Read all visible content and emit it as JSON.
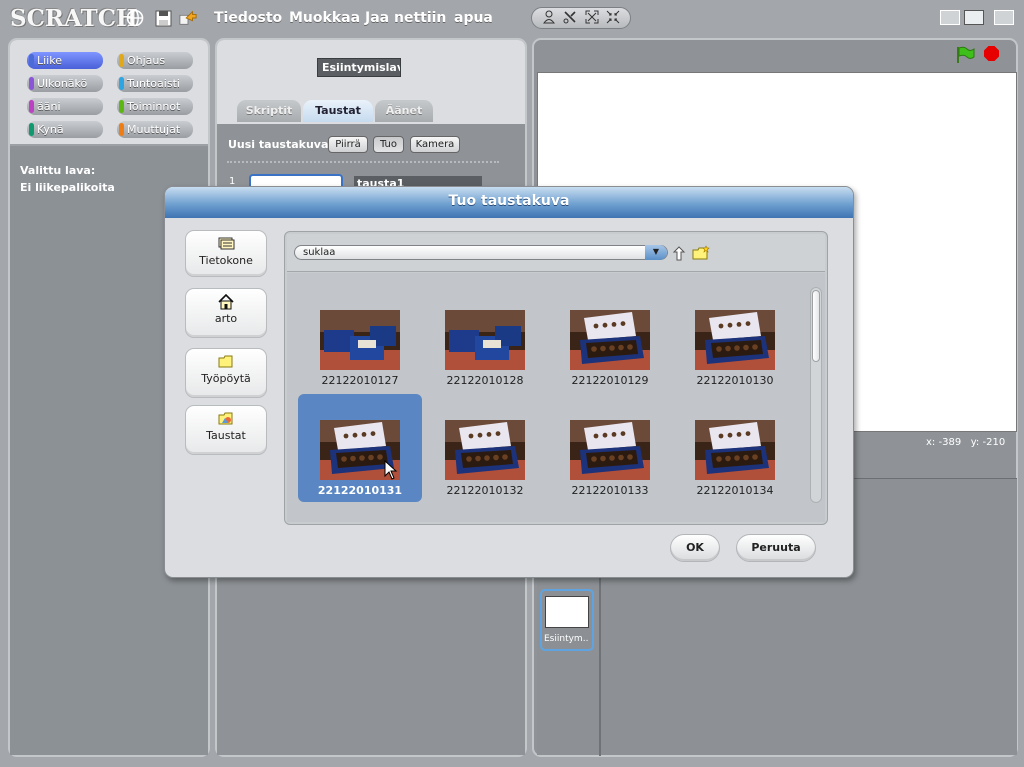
{
  "app": {
    "logo": "SCRATCH"
  },
  "menu": [
    "Tiedosto",
    "Muokkaa",
    "Jaa nettiin",
    "apua"
  ],
  "categories": [
    {
      "label": "Liike",
      "color": "#4a6cd4",
      "selected": true
    },
    {
      "label": "Ohjaus",
      "color": "#e1a91a"
    },
    {
      "label": "Ulkonäkö",
      "color": "#8a55d7"
    },
    {
      "label": "Tuntoaisti",
      "color": "#2ca5e2"
    },
    {
      "label": "ääni",
      "color": "#bb42c3"
    },
    {
      "label": "Toiminnot",
      "color": "#5cb712"
    },
    {
      "label": "Kynä",
      "color": "#0e9a6c"
    },
    {
      "label": "Muuttujat",
      "color": "#ee7d16"
    }
  ],
  "palette": {
    "line1": "Valittu lava:",
    "line2": "Ei liikepalikoita"
  },
  "sprite": {
    "name": "Esiintymislava"
  },
  "tabs": [
    {
      "label": "Skriptit"
    },
    {
      "label": "Taustat",
      "active": true
    },
    {
      "label": "Äänet"
    }
  ],
  "costumes": {
    "new_label": "Uusi taustakuva:",
    "buttons": [
      "Piirrä",
      "Tuo",
      "Kamera"
    ],
    "item_number": "1",
    "item_name": "tausta1"
  },
  "stage": {
    "x_label": "x:",
    "x_value": "-389",
    "y_label": "y:",
    "y_value": "-210",
    "thumb_label": "Esiintym.."
  },
  "dialog": {
    "title": "Tuo taustakuva",
    "places": [
      {
        "label": "Tietokone",
        "icon": "computer-icon"
      },
      {
        "label": "arto",
        "icon": "home-icon"
      },
      {
        "label": "Työpöytä",
        "icon": "folder-icon"
      },
      {
        "label": "Taustat",
        "icon": "backgrounds-folder-icon"
      }
    ],
    "folder": "suklaa",
    "files": [
      {
        "name": "22122010127",
        "variant": "boxes"
      },
      {
        "name": "22122010128",
        "variant": "boxes"
      },
      {
        "name": "22122010129",
        "variant": "open"
      },
      {
        "name": "22122010130",
        "variant": "open"
      },
      {
        "name": "22122010131",
        "variant": "open",
        "selected": true
      },
      {
        "name": "22122010132",
        "variant": "open"
      },
      {
        "name": "22122010133",
        "variant": "open"
      },
      {
        "name": "22122010134",
        "variant": "open"
      }
    ],
    "ok_label": "OK",
    "cancel_label": "Peruuta"
  }
}
